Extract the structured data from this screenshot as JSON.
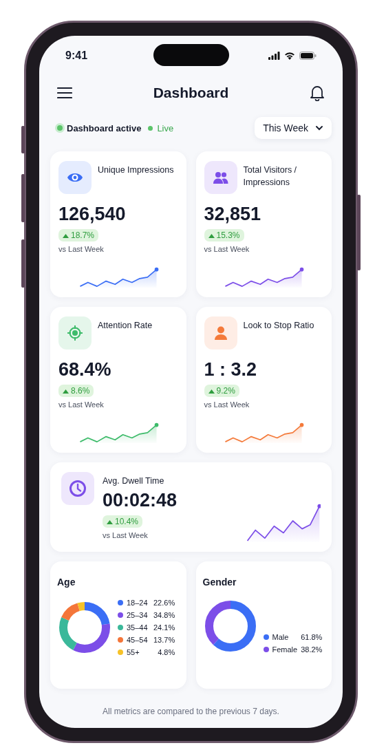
{
  "status_bar": {
    "time": "9:41"
  },
  "header": {
    "title": "Dashboard"
  },
  "status": {
    "label": "Dashboard active",
    "live": "Live",
    "period": "This Week"
  },
  "metrics": [
    {
      "title": "Unique Impressions",
      "value": "126,540",
      "trend": "18.7%",
      "note": "vs Last Week",
      "color": "#3b6ef5"
    },
    {
      "title": "Total Visitors / Impressions",
      "value": "32,851",
      "trend": "15.3%",
      "note": "vs Last Week",
      "color": "#7c4ee8"
    },
    {
      "title": "Attention Rate",
      "value": "68.4%",
      "trend": "8.6%",
      "note": "vs Last Week",
      "color": "#3dbb6a"
    },
    {
      "title": "Look to Stop Ratio",
      "value": "1 : 3.2",
      "trend": "9.2%",
      "note": "vs Last Week",
      "color": "#f47a3a"
    }
  ],
  "dwell": {
    "title": "Avg. Dwell Time",
    "value": "00:02:48",
    "trend": "10.4%",
    "note": "vs Last Week",
    "color": "#7c4ee8"
  },
  "age": {
    "title": "Age",
    "items": [
      {
        "label": "18–24",
        "value": "22.6%",
        "color": "#3b6ef5"
      },
      {
        "label": "25–34",
        "value": "34.8%",
        "color": "#7c4ee8"
      },
      {
        "label": "35–44",
        "value": "24.1%",
        "color": "#3bb89a"
      },
      {
        "label": "45–54",
        "value": "13.7%",
        "color": "#f4763a"
      },
      {
        "label": "55+",
        "value": "4.8%",
        "color": "#f6c228"
      }
    ]
  },
  "gender": {
    "title": "Gender",
    "items": [
      {
        "label": "Male",
        "value": "61.8%",
        "color": "#3b6ef5"
      },
      {
        "label": "Female",
        "value": "38.2%",
        "color": "#7c4ee8"
      }
    ]
  },
  "footer": "All metrics are compared to the previous 7 days."
}
